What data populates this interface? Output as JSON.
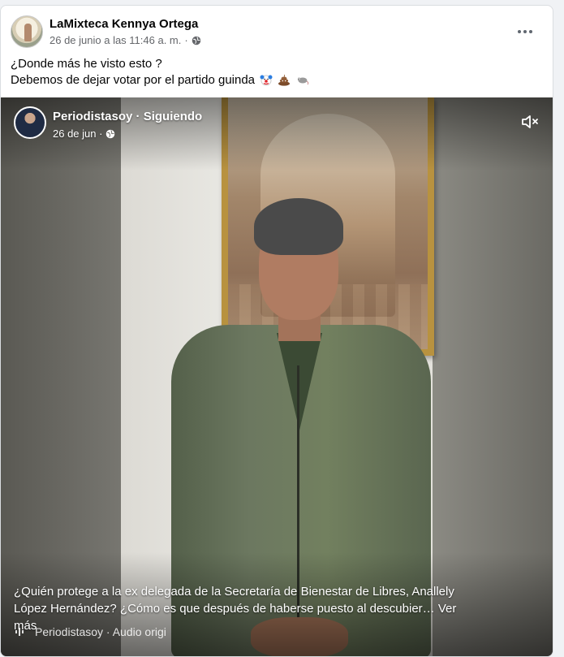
{
  "post": {
    "author": "LaMixteca Kennya Ortega",
    "timestamp": "26 de junio a las 11:46 a. m.",
    "separator": "·",
    "text_line1": "¿Donde más he visto esto ?",
    "text_line2": "Debemos de dejar votar por el partido guinda",
    "privacy_icon": "globe-icon",
    "more_icon": "more-options-icon",
    "emojis": [
      "clown-face",
      "pile-of-poo",
      "rat"
    ]
  },
  "video": {
    "author": "Periodistasoy · Siguiendo",
    "date": "26 de jun ·",
    "mute_icon": "speaker-muted-icon",
    "caption": "¿Quién protege a la ex delegada de la Secretaría de Bienestar de Libres, Anallely López Hernández? ¿Cómo es que después de haberse puesto al descubier…",
    "see_more": " Ver más",
    "audio_label": "Periodistasoy · Audio origi",
    "audio_icon": "audio-wave-icon"
  }
}
